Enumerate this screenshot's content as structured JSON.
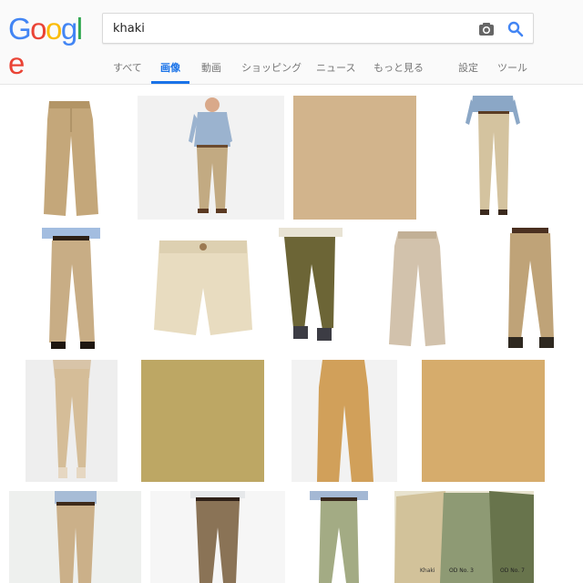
{
  "logo": {
    "text": [
      "G",
      "o",
      "o",
      "g",
      "l",
      "e"
    ],
    "colors": [
      "#4285f4",
      "#ea4335",
      "#fbbc05",
      "#4285f4",
      "#34a853",
      "#ea4335"
    ]
  },
  "search": {
    "query": "khaki"
  },
  "icons": {
    "camera": "camera-icon",
    "search": "search-icon"
  },
  "tabs": [
    {
      "label": "すべて",
      "active": false
    },
    {
      "label": "画像",
      "active": true
    },
    {
      "label": "動画",
      "active": false
    },
    {
      "label": "ショッピング",
      "active": false
    },
    {
      "label": "ニュース",
      "active": false
    },
    {
      "label": "もっと見る",
      "active": false
    },
    {
      "label": "設定",
      "active": false
    },
    {
      "label": "ツール",
      "active": false
    }
  ],
  "colors": {
    "accent": "#1a73e8",
    "search_icon": "#4285f4"
  },
  "results": {
    "row1": [
      {
        "kind": "pants",
        "name": "khaki-pants-image"
      },
      {
        "kind": "model-pants",
        "name": "man-khaki-chinos-image"
      },
      {
        "kind": "swatch",
        "name": "khaki-fabric-swatch"
      },
      {
        "kind": "model-pants",
        "name": "man-khaki-trousers-image"
      }
    ],
    "row2": [
      {
        "kind": "model-pants",
        "name": "pleated-khaki-pants-image"
      },
      {
        "kind": "shorts",
        "name": "khaki-shorts-image"
      },
      {
        "kind": "model-pants",
        "name": "olive-chinos-image"
      },
      {
        "kind": "pants",
        "name": "stone-khaki-pants-image"
      },
      {
        "kind": "model-pants",
        "name": "classic-khakis-image"
      }
    ],
    "row3": [
      {
        "kind": "model-pants",
        "name": "womens-khaki-joggers-image"
      },
      {
        "kind": "swatch",
        "name": "dark-khaki-swatch"
      },
      {
        "kind": "pants",
        "name": "tan-chinos-image"
      },
      {
        "kind": "swatch",
        "name": "light-khaki-swatch"
      }
    ],
    "row4": [
      {
        "kind": "model-pants",
        "name": "slim-khakis-image"
      },
      {
        "kind": "model-pants",
        "name": "brown-chinos-image"
      },
      {
        "kind": "model-pants",
        "name": "olive-khaki-pants-image"
      },
      {
        "kind": "shirts",
        "name": "military-shirts-image",
        "labels": [
          "Khaki",
          "OD No. 3",
          "OD No. 7"
        ]
      }
    ]
  }
}
